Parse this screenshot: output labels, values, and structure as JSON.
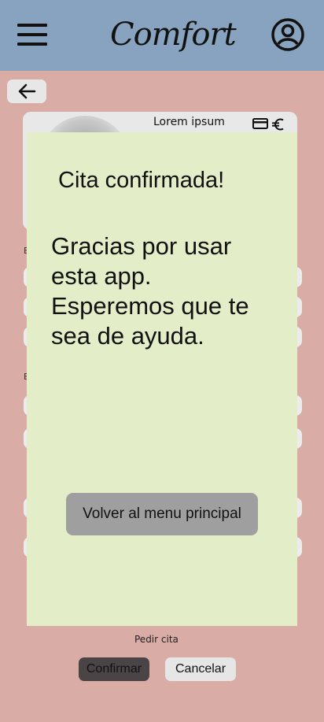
{
  "header": {
    "menu_icon": "hamburger-menu-icon",
    "logo_text": "Comfort",
    "user_icon": "account-circle-icon"
  },
  "nav": {
    "back_icon": "arrow-left-icon"
  },
  "card": {
    "title": "Lorem ipsum",
    "icons": [
      "credit-card-icon",
      "euro-icon"
    ]
  },
  "modal": {
    "title": "Cita confirmada!",
    "message": "Gracias por usar esta app. Esperemos que te sea de ayuda.",
    "button_label": "Volver al menu principal"
  },
  "footer": {
    "section_label": "Pedir cita",
    "confirm_label": "Confirmar",
    "cancel_label": "Cancelar"
  },
  "colors": {
    "header_bg": "#88a3bf",
    "page_bg": "#d9aca6",
    "modal_bg": "#e3eec9",
    "modal_button_bg": "#a09f9f",
    "confirm_bg": "#4a4446"
  }
}
